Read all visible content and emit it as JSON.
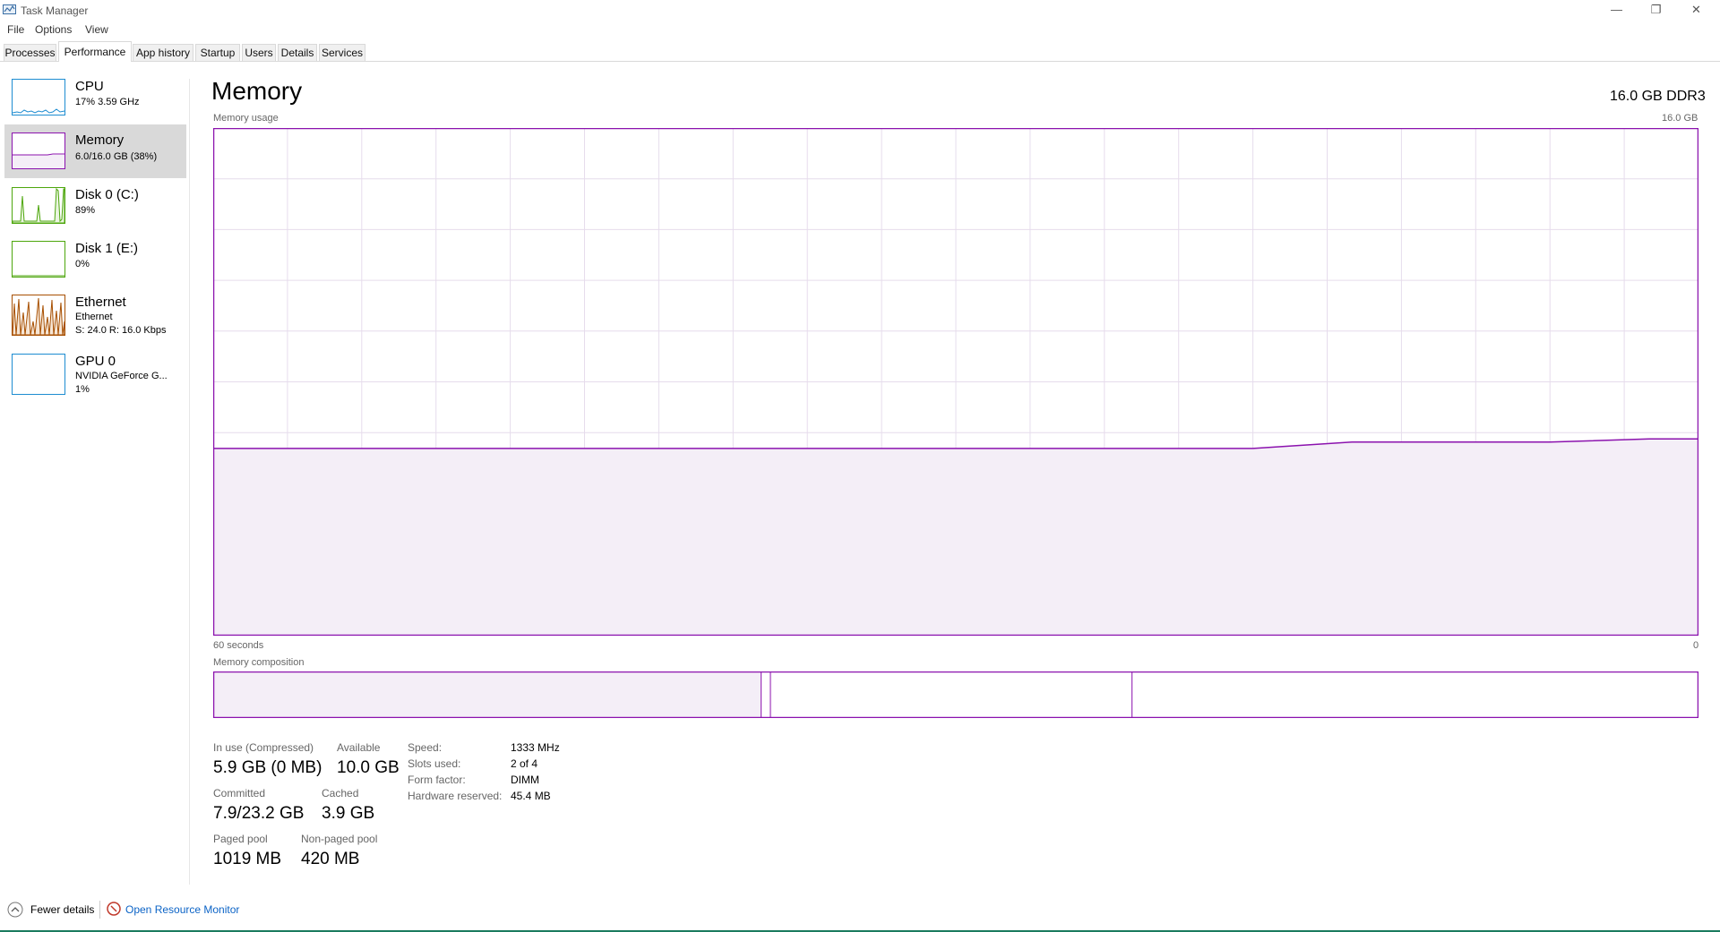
{
  "window": {
    "title": "Task Manager",
    "controls": {
      "minimize": "—",
      "restore": "❐",
      "close": "✕"
    }
  },
  "menu": [
    "File",
    "Options",
    "View"
  ],
  "tabs": [
    "Processes",
    "Performance",
    "App history",
    "Startup",
    "Users",
    "Details",
    "Services"
  ],
  "sidebar": {
    "items": [
      {
        "name": "CPU",
        "sub1": "17%  3.59 GHz",
        "sub2": "",
        "color": "#1d8cd1"
      },
      {
        "name": "Memory",
        "sub1": "6.0/16.0 GB (38%)",
        "sub2": "",
        "color": "#8b12ae"
      },
      {
        "name": "Disk 0 (C:)",
        "sub1": "89%",
        "sub2": "",
        "color": "#4da60c"
      },
      {
        "name": "Disk 1 (E:)",
        "sub1": "0%",
        "sub2": "",
        "color": "#4da60c"
      },
      {
        "name": "Ethernet",
        "sub1": "Ethernet",
        "sub2": "S: 24.0  R: 16.0 Kbps",
        "color": "#a74f01"
      },
      {
        "name": "GPU 0",
        "sub1": "NVIDIA GeForce G...",
        "sub2": "1%",
        "color": "#1d8cd1"
      }
    ]
  },
  "main": {
    "title": "Memory",
    "spec": "16.0 GB DDR3",
    "usage_label": "Memory usage",
    "usage_max": "16.0 GB",
    "x_left": "60 seconds",
    "x_right": "0",
    "composition_label": "Memory composition",
    "accent": "#8b12ae"
  },
  "stats": {
    "in_use_label": "In use (Compressed)",
    "in_use_value": "5.9 GB (0 MB)",
    "available_label": "Available",
    "available_value": "10.0 GB",
    "committed_label": "Committed",
    "committed_value": "7.9/23.2 GB",
    "cached_label": "Cached",
    "cached_value": "3.9 GB",
    "paged_label": "Paged pool",
    "paged_value": "1019 MB",
    "nonpaged_label": "Non-paged pool",
    "nonpaged_value": "420 MB"
  },
  "details": [
    {
      "label": "Speed:",
      "value": "1333 MHz"
    },
    {
      "label": "Slots used:",
      "value": "2 of 4"
    },
    {
      "label": "Form factor:",
      "value": "DIMM"
    },
    {
      "label": "Hardware reserved:",
      "value": "45.4 MB"
    }
  ],
  "footer": {
    "fewer_details": "Fewer details",
    "resource_monitor": "Open Resource Monitor"
  },
  "chart_data": {
    "type": "area",
    "title": "",
    "xlabel": "",
    "ylabel": "Memory usage",
    "x_range_seconds": [
      60,
      0
    ],
    "y_range_gb": [
      0,
      16.0
    ],
    "series": [
      {
        "x": [
          60,
          50,
          40,
          30,
          22,
          18,
          14,
          10,
          6,
          2,
          0
        ],
        "values": [
          5.9,
          5.9,
          5.9,
          5.9,
          5.9,
          5.9,
          6.1,
          6.1,
          6.1,
          6.2,
          6.2
        ]
      }
    ],
    "composition": {
      "in_use_gb": 5.9,
      "modified_gb": 0.1,
      "standby_gb": 3.9,
      "free_gb": 6.1
    },
    "grid": true
  }
}
